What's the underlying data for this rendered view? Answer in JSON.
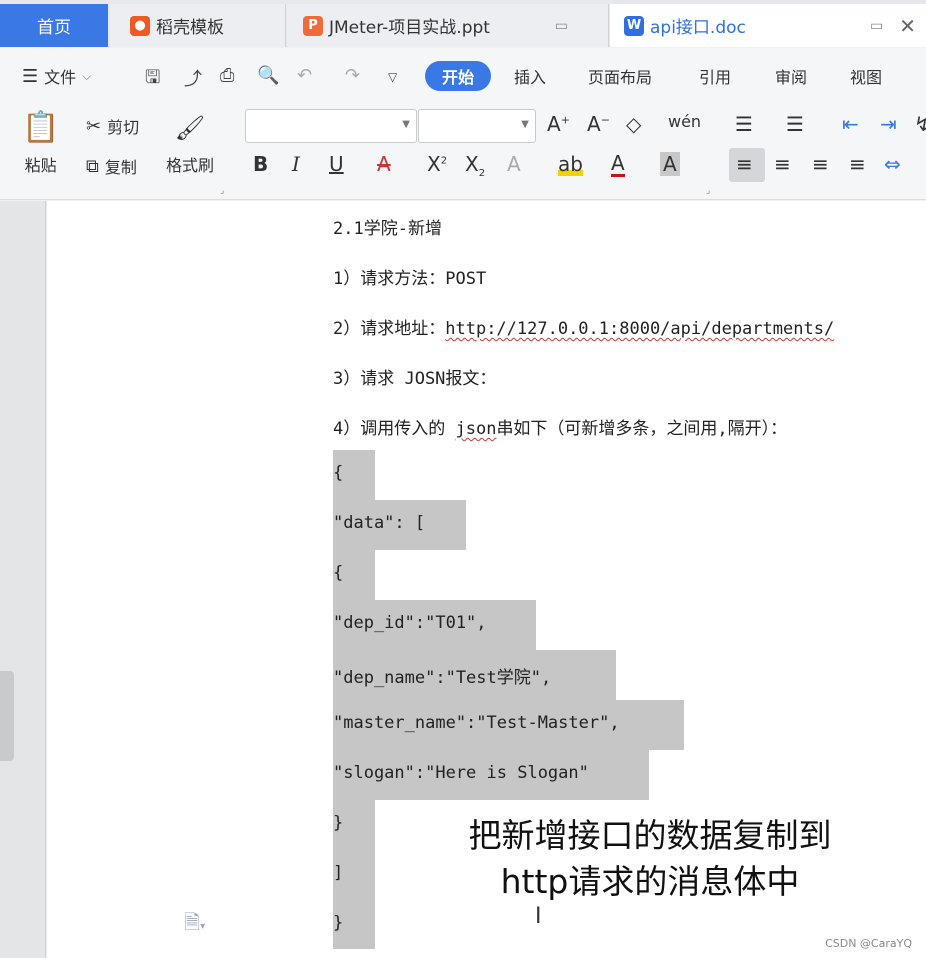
{
  "tabs": [
    {
      "label": "首页",
      "icon": "home"
    },
    {
      "label": "稻壳模板",
      "icon": "daoke-logo-icon"
    },
    {
      "label": "JMeter-项目实战.ppt",
      "icon": "ppt-icon"
    },
    {
      "label": "api接口.doc",
      "icon": "word-doc-icon"
    }
  ],
  "menu": {
    "file": "文件",
    "tabs": [
      "开始",
      "插入",
      "页面布局",
      "引用",
      "审阅",
      "视图"
    ],
    "active_tab": "开始"
  },
  "ribbon": {
    "paste": "粘贴",
    "cut": "剪切",
    "copy": "复制",
    "format_painter": "格式刷",
    "font_name": "",
    "font_size": ""
  },
  "document": {
    "paragraphs": [
      "2.1学院-新增",
      "1）请求方法：POST",
      "2）请求地址：",
      "3）请求 JOSN报文：",
      "4）调用传入的 "
    ],
    "url": "http://127.0.0.1:8000/api/departments/",
    "json_word": "json",
    "p4_rest": "串如下（可新增多条，之间用,隔开）：",
    "code_lines": [
      "{",
      "\"data\": [",
      "{",
      "\"dep_id\":\"T01\",",
      "\"dep_name\":\"Test学院\",",
      "\"master_name\":\"Test-Master\",",
      "\"slogan\":\"Here is Slogan\"",
      "}",
      "]",
      "}"
    ]
  },
  "caption": {
    "line1": "把新增接口的数据复制到",
    "line2": "http请求的消息体中"
  },
  "watermark": "CSDN @CaraYQ",
  "colors": {
    "accent": "#3a78e6",
    "selection": "#c6c6c6"
  }
}
